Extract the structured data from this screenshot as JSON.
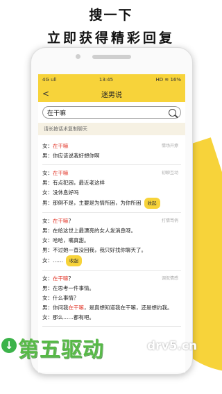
{
  "headline": {
    "line1": "搜一下",
    "line2": "立即获得精彩回复"
  },
  "status_bar": {
    "left": "4G ull",
    "time": "13:45",
    "right": "HD ≋ 16%"
  },
  "app_bar": {
    "back_icon": "back-arrow-icon",
    "title": "迷男说"
  },
  "search": {
    "value": "在干嘛",
    "icon": "search-icon"
  },
  "hint": "请长按话术复制聊天",
  "cards": [
    {
      "tag": "情场开撩",
      "lines": [
        {
          "prefix": "女：",
          "hl": "在干嘛",
          "suffix": "",
          "collapse": ""
        },
        {
          "prefix": "男：你应该说我好想你啊",
          "hl": "",
          "suffix": "",
          "collapse": ""
        }
      ]
    },
    {
      "tag": "初聊互动",
      "lines": [
        {
          "prefix": "女：",
          "hl": "在干嘛",
          "suffix": "",
          "collapse": ""
        },
        {
          "prefix": "男：有点犯困，最近老这样",
          "hl": "",
          "suffix": "",
          "collapse": ""
        },
        {
          "prefix": "女：没休息好吗",
          "hl": "",
          "suffix": "",
          "collapse": ""
        },
        {
          "prefix": "男：那倒不是，主要是为情所困，为你所困",
          "hl": "",
          "suffix": "",
          "collapse": "收起"
        }
      ]
    },
    {
      "tag": "打情骂俏",
      "lines": [
        {
          "prefix": "女：",
          "hl": "在干嘛",
          "suffix": "？",
          "collapse": ""
        },
        {
          "prefix": "男：在给这世上最漂亮的女人发消息呀。",
          "hl": "",
          "suffix": "",
          "collapse": ""
        },
        {
          "prefix": "女：哈哈，嘴真甜。",
          "hl": "",
          "suffix": "",
          "collapse": ""
        },
        {
          "prefix": "男：不过她一直没回我，我只好找你聊天了。",
          "hl": "",
          "suffix": "",
          "collapse": ""
        },
        {
          "prefix": "女：……",
          "hl": "",
          "suffix": "",
          "collapse": "收起"
        }
      ]
    },
    {
      "tag": "调侃情感",
      "lines": [
        {
          "prefix": "女：",
          "hl": "在干嘛",
          "suffix": "？",
          "collapse": ""
        },
        {
          "prefix": "男：在思考一件事情。",
          "hl": "",
          "suffix": "",
          "collapse": ""
        },
        {
          "prefix": "女：什么事情？",
          "hl": "",
          "suffix": "",
          "collapse": ""
        },
        {
          "prefix": "男：你问我",
          "hl": "在干嘛",
          "suffix": "，是真想知道我在干嘛，还是想约我。",
          "collapse": ""
        },
        {
          "prefix": "女：那么……都有吧。",
          "hl": "",
          "suffix": "",
          "collapse": ""
        }
      ]
    }
  ],
  "watermark": {
    "cn": "第五驱动",
    "en": "drv5.cn",
    "icon": "download-arrow-icon"
  }
}
